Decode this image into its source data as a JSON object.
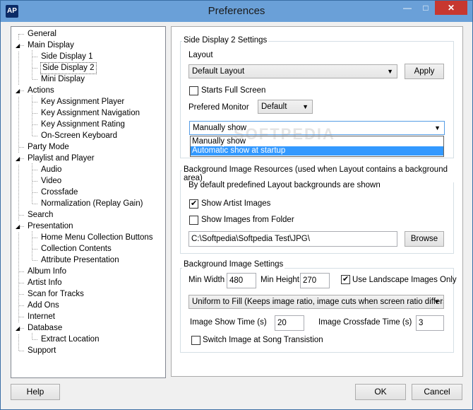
{
  "window": {
    "title": "Preferences",
    "app_icon_text": "AP",
    "minimize_glyph": "—",
    "maximize_glyph": "□",
    "close_glyph": "✕"
  },
  "tree": {
    "items": [
      {
        "label": "General",
        "level": 0
      },
      {
        "label": "Main Display",
        "level": 0
      },
      {
        "label": "Side Display 1",
        "level": 1
      },
      {
        "label": "Side Display 2",
        "level": 1,
        "selected": true
      },
      {
        "label": "Mini Display",
        "level": 1
      },
      {
        "label": "Actions",
        "level": 0
      },
      {
        "label": "Key Assignment Player",
        "level": 1
      },
      {
        "label": "Key Assignment Navigation",
        "level": 1
      },
      {
        "label": "Key Assignment Rating",
        "level": 1
      },
      {
        "label": "On-Screen Keyboard",
        "level": 1
      },
      {
        "label": "Party Mode",
        "level": 0
      },
      {
        "label": "Playlist and Player",
        "level": 0
      },
      {
        "label": "Audio",
        "level": 1
      },
      {
        "label": "Video",
        "level": 1
      },
      {
        "label": "Crossfade",
        "level": 1
      },
      {
        "label": "Normalization (Replay Gain)",
        "level": 1
      },
      {
        "label": "Search",
        "level": 0
      },
      {
        "label": "Presentation",
        "level": 0
      },
      {
        "label": "Home Menu Collection Buttons",
        "level": 1
      },
      {
        "label": "Collection Contents",
        "level": 1
      },
      {
        "label": "Attribute Presentation",
        "level": 1
      },
      {
        "label": "Album Info",
        "level": 0
      },
      {
        "label": "Artist Info",
        "level": 0
      },
      {
        "label": "Scan for Tracks",
        "level": 0
      },
      {
        "label": "Add Ons",
        "level": 0
      },
      {
        "label": "Internet",
        "level": 0
      },
      {
        "label": "Database",
        "level": 0
      },
      {
        "label": "Extract Location",
        "level": 1
      },
      {
        "label": "Support",
        "level": 0
      }
    ]
  },
  "side_display": {
    "group_title": "Side Display 2 Settings",
    "layout_label": "Layout",
    "layout_value": "Default Layout",
    "apply_button": "Apply",
    "starts_full_screen_label": "Starts Full Screen",
    "starts_full_screen_checked": false,
    "prefered_monitor_label": "Prefered Monitor",
    "prefered_monitor_value": "Default",
    "show_mode_value": "Manually show",
    "show_mode_options": [
      "Manually show",
      "Automatic show at startup"
    ],
    "show_mode_highlighted": "Automatic show at startup"
  },
  "background_resources": {
    "group_title": "Background Image Resources (used when Layout contains a background area)",
    "info_text": "By default predefined Layout backgrounds are shown",
    "show_artist_images_label": "Show Artist Images",
    "show_artist_images_checked": true,
    "show_images_from_folder_label": "Show Images from Folder",
    "show_images_from_folder_checked": false,
    "folder_path": "C:\\Softpedia\\Softpedia Test\\JPG\\",
    "browse_button": "Browse"
  },
  "background_settings": {
    "group_title": "Background Image Settings",
    "min_width_label": "Min Width",
    "min_width_value": "480",
    "min_height_label": "Min Height",
    "min_height_value": "270",
    "use_landscape_label": "Use Landscape Images Only",
    "use_landscape_checked": true,
    "fill_mode_value": "Uniform to Fill (Keeps image ratio, image cuts when screen ratio differs",
    "show_time_label": "Image Show Time (s)",
    "show_time_value": "20",
    "crossfade_time_label": "Image Crossfade Time (s)",
    "crossfade_time_value": "3",
    "switch_on_song_label": "Switch Image at Song Transistion",
    "switch_on_song_checked": false
  },
  "footer": {
    "help_button": "Help",
    "ok_button": "OK",
    "cancel_button": "Cancel"
  },
  "watermark": "SOFTPEDIA"
}
